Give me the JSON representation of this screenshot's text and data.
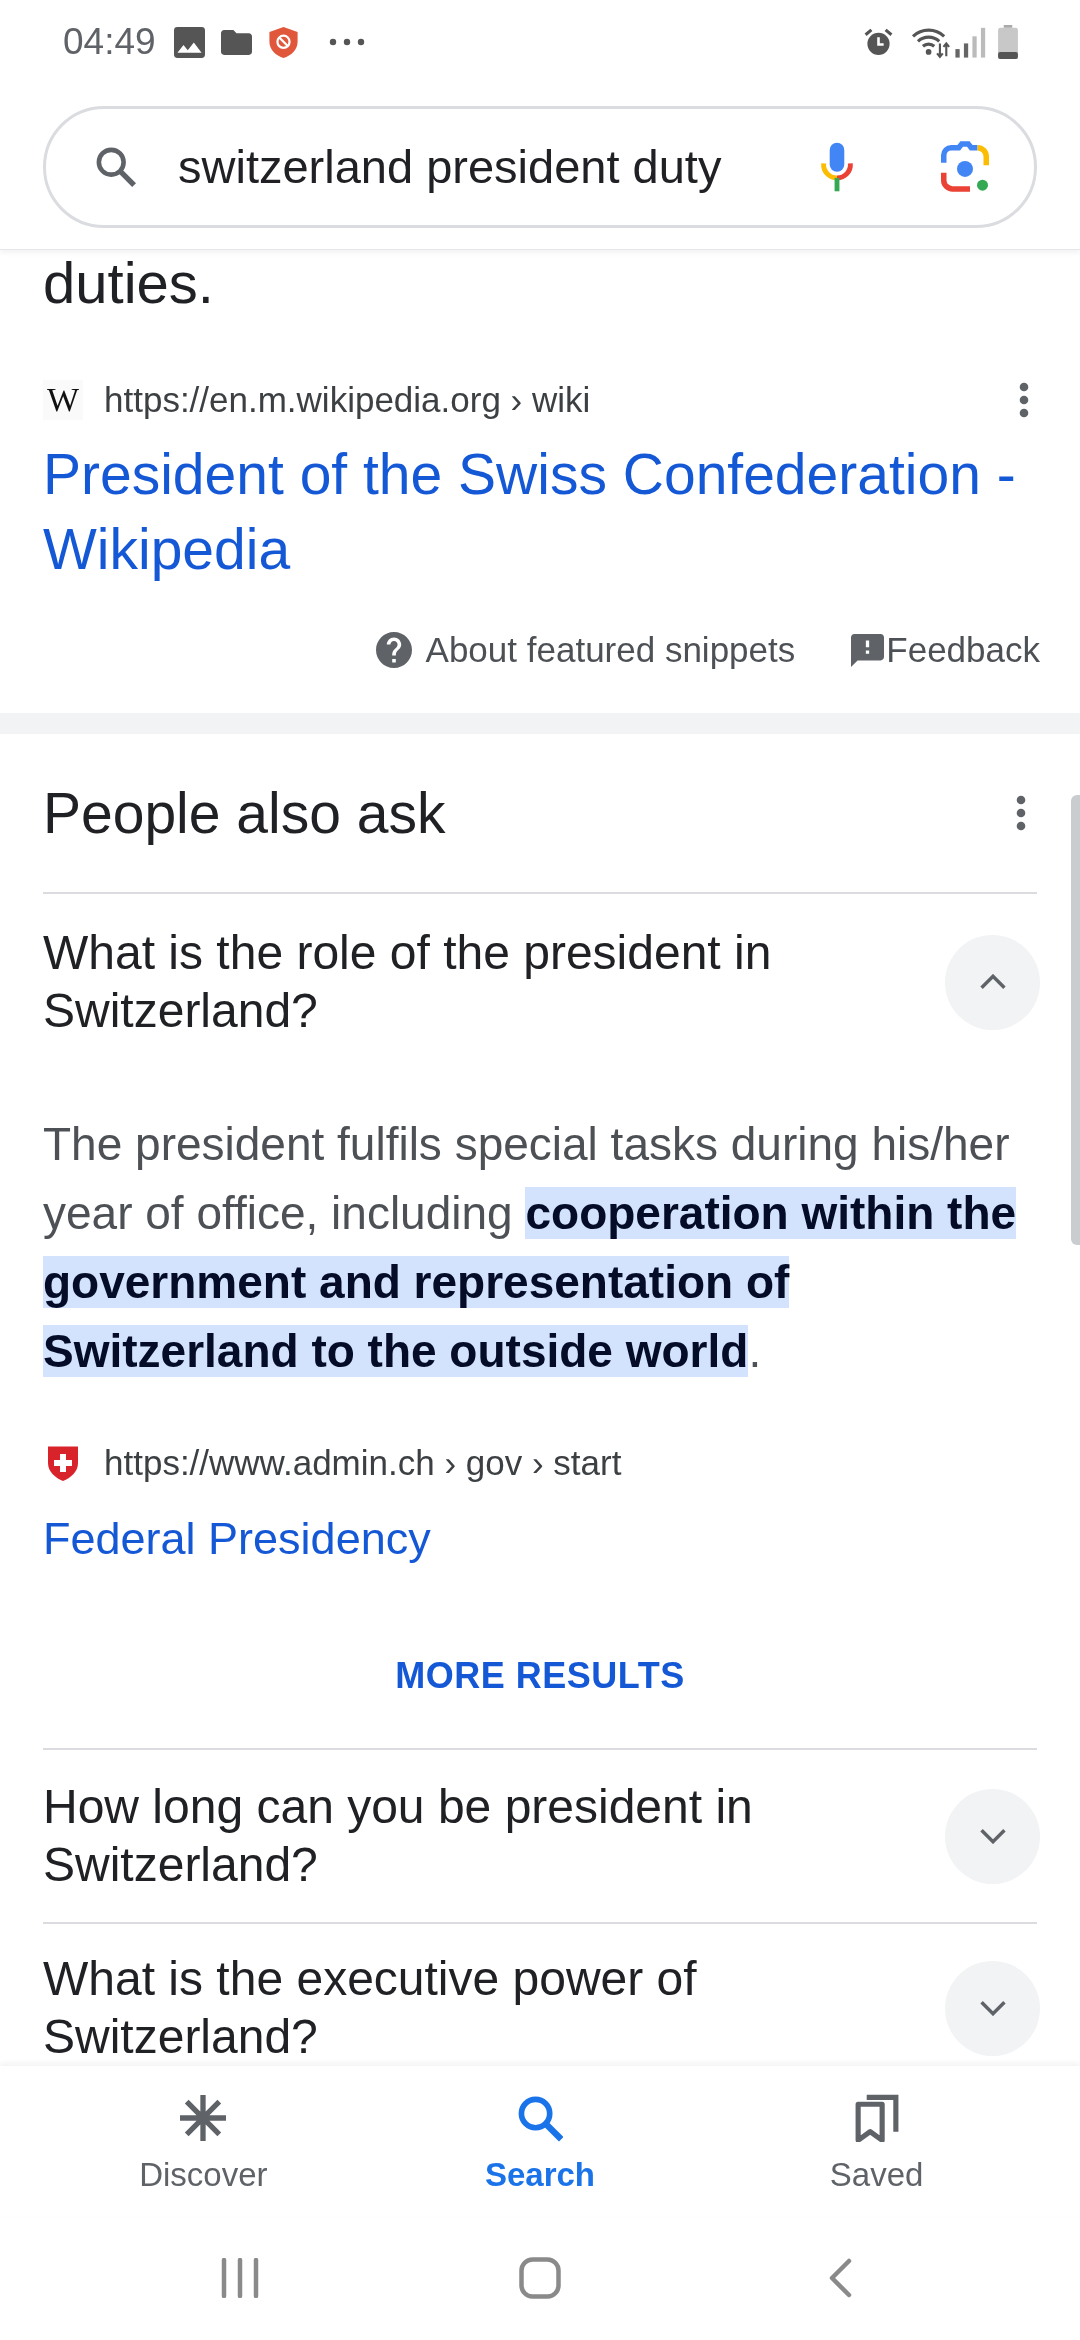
{
  "status_bar": {
    "time": "04:49"
  },
  "search_bar": {
    "value": "switzerland president duty"
  },
  "featured_snippet": {
    "text": "duties.",
    "source": {
      "favicon": "W",
      "url": "https://en.m.wikipedia.org › wiki",
      "title": "President of the Swiss Confederation - Wikipedia"
    },
    "footer": {
      "about": "About featured snippets",
      "feedback": "Feedback"
    }
  },
  "people_also_ask": {
    "title": "People also ask",
    "questions": [
      {
        "question": "What is the role of the president in Switzerland?",
        "expanded": true,
        "answer": "The president fulfils special tasks during his/her year of office, including **cooperation within the government and representation of Switzerland to the outside world**.",
        "source": {
          "url": "https://www.admin.ch › gov › start",
          "title": "Federal Presidency"
        },
        "more_results": "MORE RESULTS"
      },
      {
        "question": "How long can you be president in Switzerland?",
        "expanded": false
      },
      {
        "question": "What is the executive power of Switzerland?",
        "expanded": false
      }
    ]
  },
  "bottom_nav": [
    {
      "label": "Discover",
      "selected": false
    },
    {
      "label": "Search",
      "selected": true
    },
    {
      "label": "Saved",
      "selected": false
    }
  ]
}
